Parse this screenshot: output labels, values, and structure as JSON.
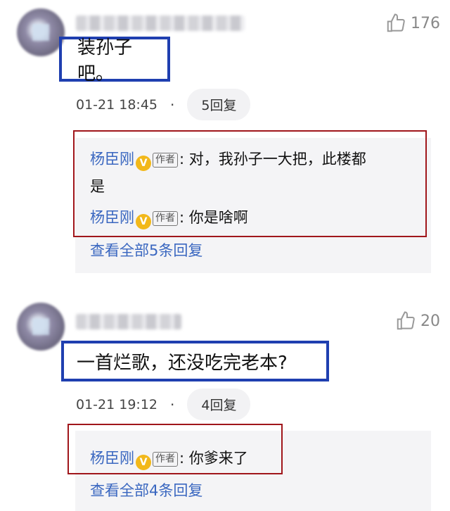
{
  "comments": [
    {
      "text": "装孙子吧。",
      "likes": "176",
      "date": "01-21 18:45",
      "dot": "·",
      "reply_count": "5回复",
      "replies": [
        {
          "name": "杨臣刚",
          "badge": "V",
          "tag": "作者",
          "text": ": 对，我孙子一大把，此楼都",
          "text2": "是"
        },
        {
          "name": "杨臣刚",
          "badge": "V",
          "tag": "作者",
          "text": ": 你是啥啊"
        }
      ],
      "view_all": "查看全部5条回复"
    },
    {
      "text": "一首烂歌，还没吃完老本?",
      "likes": "20",
      "date": "01-21 19:12",
      "dot": "·",
      "reply_count": "4回复",
      "replies": [
        {
          "name": "杨臣刚",
          "badge": "V",
          "tag": "作者",
          "text": ": 你爹来了"
        }
      ],
      "view_all": "查看全部4条回复"
    }
  ],
  "icons": {
    "like": "thumbs-up-icon",
    "verified": "verified-badge-icon"
  },
  "colors": {
    "highlight_blue": "#1f3fb0",
    "highlight_red": "#a0161b",
    "link": "#3a67c0",
    "badge": "#f2b81a"
  }
}
